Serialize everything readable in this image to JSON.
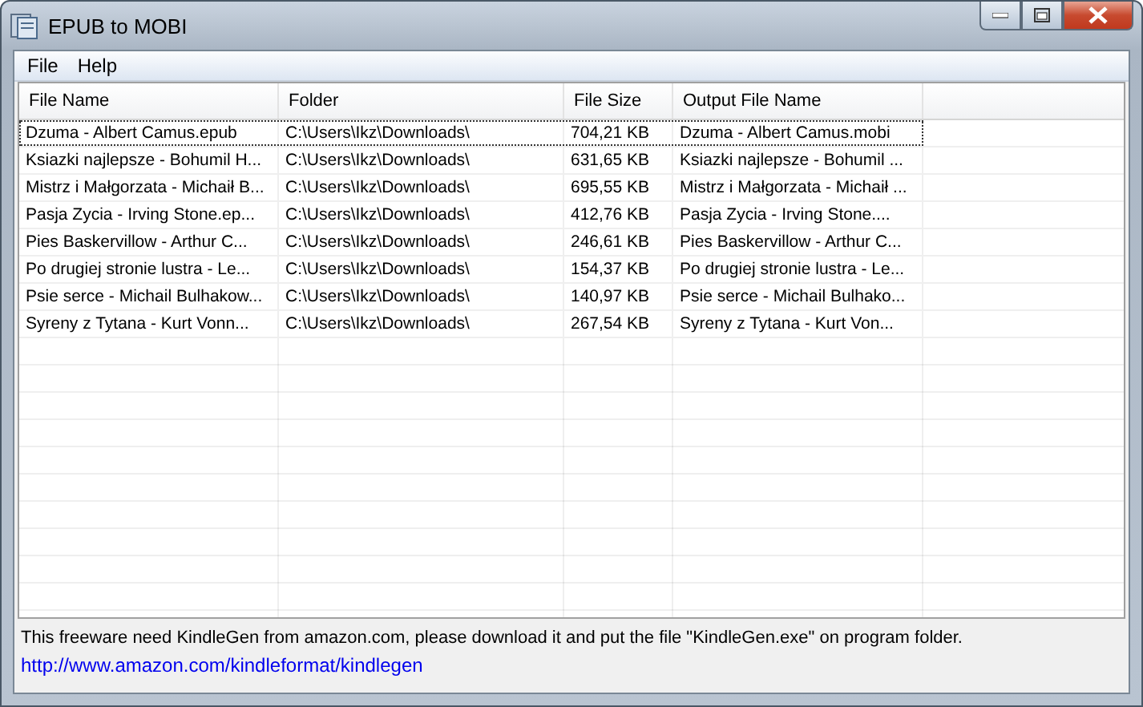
{
  "window": {
    "title": "EPUB to MOBI"
  },
  "menu": [
    "File",
    "Help"
  ],
  "table": {
    "columns": [
      "File Name",
      "Folder",
      "File Size",
      "Output File Name"
    ],
    "rows": [
      {
        "cells": [
          "Dzuma - Albert Camus.epub",
          "C:\\Users\\Ikz\\Downloads\\",
          "704,21 KB",
          "Dzuma - Albert Camus.mobi"
        ],
        "focused": true
      },
      {
        "cells": [
          "Ksiazki najlepsze - Bohumil H...",
          "C:\\Users\\Ikz\\Downloads\\",
          "631,65 KB",
          "Ksiazki najlepsze - Bohumil ..."
        ],
        "focused": false
      },
      {
        "cells": [
          "Mistrz i Małgorzata - Michaił B...",
          "C:\\Users\\Ikz\\Downloads\\",
          "695,55 KB",
          "Mistrz i Małgorzata - Michaił ..."
        ],
        "focused": false
      },
      {
        "cells": [
          "Pasja Zycia - Irving Stone.ep...",
          "C:\\Users\\Ikz\\Downloads\\",
          "412,76 KB",
          "Pasja Zycia - Irving Stone...."
        ],
        "focused": false
      },
      {
        "cells": [
          "Pies Baskervillow - Arthur C...",
          "C:\\Users\\Ikz\\Downloads\\",
          "246,61 KB",
          "Pies Baskervillow - Arthur C..."
        ],
        "focused": false
      },
      {
        "cells": [
          "Po drugiej stronie lustra - Le...",
          "C:\\Users\\Ikz\\Downloads\\",
          "154,37 KB",
          "Po drugiej stronie lustra - Le..."
        ],
        "focused": false
      },
      {
        "cells": [
          "Psie serce - Michail Bulhakow...",
          "C:\\Users\\Ikz\\Downloads\\",
          "140,97 KB",
          "Psie serce - Michail Bulhako..."
        ],
        "focused": false
      },
      {
        "cells": [
          "Syreny z Tytana - Kurt Vonn...",
          "C:\\Users\\Ikz\\Downloads\\",
          "267,54 KB",
          "Syreny z Tytana - Kurt Von..."
        ],
        "focused": false
      }
    ]
  },
  "footer": {
    "notice": "This freeware need KindleGen from amazon.com, please download it and put the file \"KindleGen.exe\" on program folder.",
    "link": "http://www.amazon.com/kindleformat/kindlegen"
  }
}
